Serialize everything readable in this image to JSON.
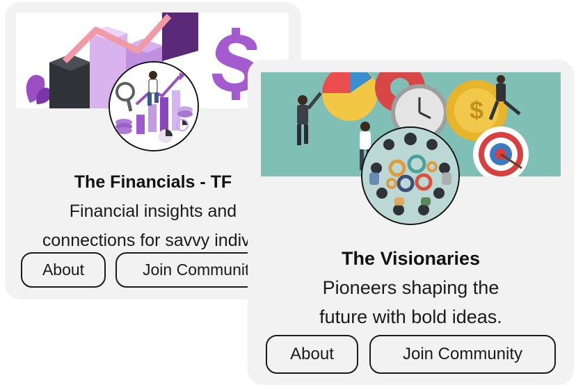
{
  "communities": [
    {
      "title": "The Financials - TF",
      "description_lines": [
        "Financial insights and",
        "connections for savvy individ"
      ],
      "about_label": "About",
      "join_label": "Join Communit"
    },
    {
      "title": "The Visionaries",
      "description_lines": [
        "Pioneers shaping the",
        "future with bold ideas."
      ],
      "about_label": "About",
      "join_label": "Join Community"
    }
  ],
  "colors": {
    "card_background": "#f2f2f2",
    "border": "#1a1a1a",
    "text": "#111111",
    "finance_purple": "#b06fd6",
    "teal_banner": "#7fbfb5"
  },
  "icons": [
    "finance-illustration",
    "dollar-sign-icon",
    "magnifier-icon",
    "gears-teamwork-illustration",
    "target-icon"
  ]
}
